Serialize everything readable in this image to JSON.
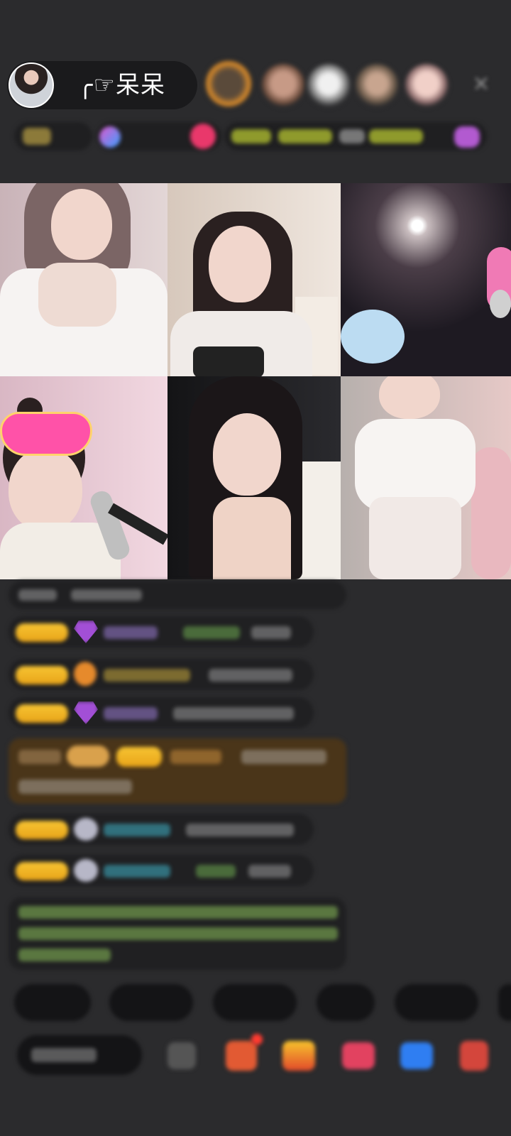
{
  "host": {
    "name": "╭☞呆呆"
  },
  "header": {
    "close_icon": "close-icon"
  },
  "colors": {
    "background": "#2b2b2d",
    "badge_gold": "#f2b424",
    "highlight_message_bg": "#4a3519",
    "notice_text": "#8bbf5a",
    "username_cyan": "#3fb3c9",
    "username_purple": "#9b7bd3"
  },
  "icons": {
    "close": "close-icon",
    "gift": "gift-icon",
    "diamond": "diamond-icon"
  }
}
